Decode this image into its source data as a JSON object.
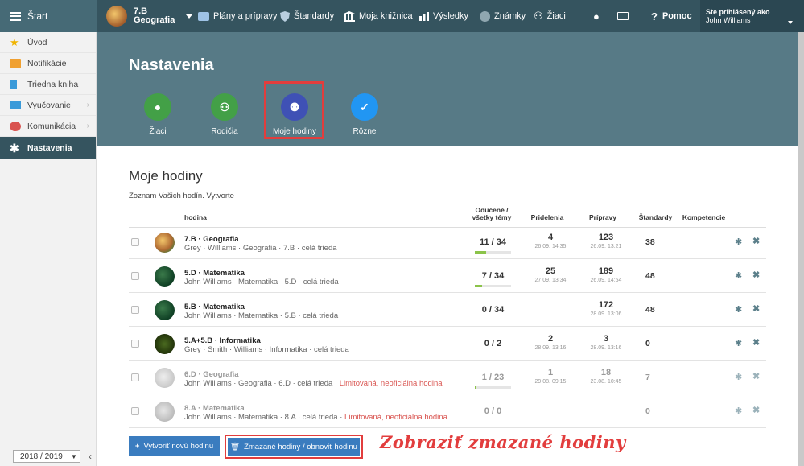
{
  "topbar": {
    "start_label": "Štart",
    "class_name": "7.B",
    "class_subject": "Geografia",
    "nav": [
      {
        "label": "Plány a prípravy",
        "icon": "folder-icon",
        "color": "#9ec3e6"
      },
      {
        "label": "Štandardy",
        "icon": "shield-icon",
        "color": "#b9cfe0"
      },
      {
        "label": "Moja knižnica",
        "icon": "library-icon",
        "color": "#ffffff"
      },
      {
        "label": "Výsledky",
        "icon": "bar-chart-icon",
        "color": "#ffffff"
      },
      {
        "label": "Známky",
        "icon": "grade-icon",
        "color": "#ffffff"
      },
      {
        "label": "Žiaci",
        "icon": "students-icon",
        "color": "#ffffff"
      }
    ],
    "help_label": "Pomoc",
    "user_prefix": "Ste prihlásený ako",
    "user_name": "John Williams"
  },
  "sidebar": {
    "items": [
      {
        "label": "Úvod",
        "icon": "star-icon",
        "color": "#f0b400"
      },
      {
        "label": "Notifikácie",
        "icon": "mail-icon",
        "color": "#f0a030"
      },
      {
        "label": "Triedna kniha",
        "icon": "book-icon",
        "color": "#3a9ad9"
      },
      {
        "label": "Vyučovanie",
        "icon": "teaching-icon",
        "color": "#3a9ad9"
      },
      {
        "label": "Komunikácia",
        "icon": "chat-icon",
        "color": "#d9534f"
      },
      {
        "label": "Nastavenia",
        "icon": "settings-icon",
        "color": "#ffffff"
      }
    ],
    "year": "2018 / 2019"
  },
  "header": {
    "title": "Nastavenia",
    "tabs": [
      {
        "label": "Žiaci",
        "color": "#43a047"
      },
      {
        "label": "Rodičia",
        "color": "#43a047"
      },
      {
        "label": "Moje hodiny",
        "color": "#3f51b5"
      },
      {
        "label": "Rôzne",
        "color": "#2196f3"
      }
    ]
  },
  "main": {
    "title": "Moje hodiny",
    "subtitle": "Zoznam Vašich hodín. Vytvorte",
    "columns": {
      "lesson": "hodina",
      "taught_1": "Odučené /",
      "taught_2": "všetky témy",
      "assignments": "Pridelenia",
      "preparations": "Prípravy",
      "standards": "Štandardy",
      "competences": "Kompetencie"
    },
    "rows": [
      {
        "name": "7.B · Geografia",
        "detail": "Grey · Williams · Geografia · 7.B · celá trieda",
        "limited": "",
        "taught": "11 / 34",
        "progress": 0.32,
        "assign": "4",
        "assign_date": "26.09. 14:35",
        "prep": "123",
        "prep_date": "26.09. 13:21",
        "std": "38",
        "avatar": "geo"
      },
      {
        "name": "5.D · Matematika",
        "detail": "John Williams · Matematika · 5.D · celá trieda",
        "limited": "",
        "taught": "7 / 34",
        "progress": 0.21,
        "assign": "25",
        "assign_date": "27.09. 13:34",
        "prep": "189",
        "prep_date": "26.09. 14:54",
        "std": "48",
        "avatar": "math"
      },
      {
        "name": "5.B · Matematika",
        "detail": "John Williams · Matematika · 5.B · celá trieda",
        "limited": "",
        "taught": "0 / 34",
        "progress": 0,
        "assign": "",
        "assign_date": "",
        "prep": "172",
        "prep_date": "28.09. 13:06",
        "std": "48",
        "avatar": "math"
      },
      {
        "name": "5.A+5.B · Informatika",
        "detail": "Grey · Smith · Williams · Informatika · celá trieda",
        "limited": "",
        "taught": "0 / 2",
        "progress": 0,
        "assign": "2",
        "assign_date": "28.09. 13:16",
        "prep": "3",
        "prep_date": "28.09. 13:16",
        "std": "0",
        "avatar": "it"
      },
      {
        "name": "6.D · Geografia",
        "detail": "John Williams · Geografia · 6.D · celá trieda ·",
        "limited": "Limitovaná, neoficiálna hodina",
        "taught": "1 / 23",
        "progress": 0.04,
        "assign": "1",
        "assign_date": "29.08. 09:15",
        "prep": "18",
        "prep_date": "23.08. 10:45",
        "std": "7",
        "avatar": "faded"
      },
      {
        "name": "8.A · Matematika",
        "detail": "John Williams · Matematika · 8.A · celá trieda ·",
        "limited": "Limitovaná, neoficiálna hodina",
        "taught": "0 / 0",
        "progress": 0,
        "assign": "",
        "assign_date": "",
        "prep": "",
        "prep_date": "",
        "std": "0",
        "avatar": "faded2"
      }
    ],
    "new_button": "Vytvoriť novú hodinu",
    "deleted_button": "Zmazané hodiny / obnoviť hodinu",
    "annotation": "Zobraziť zmazané hodiny"
  }
}
